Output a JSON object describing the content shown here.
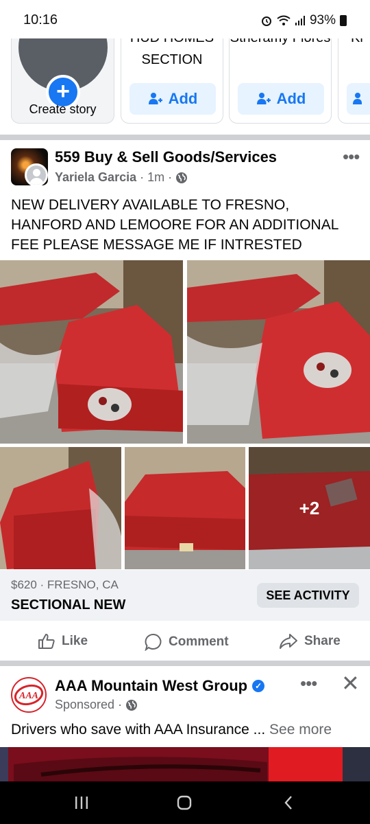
{
  "status_bar": {
    "time": "10:16",
    "battery": "93%"
  },
  "stories": {
    "create_label": "Create story",
    "cards": [
      {
        "name": "HUD HOMES SECTION",
        "add_label": "Add"
      },
      {
        "name": "Stheramy Flores",
        "add_label": "Add"
      },
      {
        "name": "Ki",
        "add_label": "Add"
      }
    ]
  },
  "post": {
    "group_name": "559 Buy & Sell Goods/Services",
    "author": "Yariela Garcia",
    "time": "1m",
    "text": "NEW DELIVERY AVAILABLE TO FRESNO, HANFORD AND LEMOORE FOR AN ADDITIONAL FEE PLEASE MESSAGE ME IF INTRESTED",
    "more_photos": "+2",
    "listing": {
      "price_location": "$620 · FRESNO, CA",
      "title": "SECTIONAL NEW",
      "cta": "SEE ACTIVITY"
    },
    "actions": {
      "like": "Like",
      "comment": "Comment",
      "share": "Share"
    }
  },
  "ad": {
    "advertiser": "AAA Mountain West Group",
    "logo_text": "AAA",
    "sponsored": "Sponsored",
    "text": "Drivers who save with AAA Insurance ...",
    "see_more": "See more"
  },
  "colors": {
    "brand_blue": "#1877f2",
    "sofa_red": "#c9282c",
    "secondary_text": "#65676b"
  }
}
